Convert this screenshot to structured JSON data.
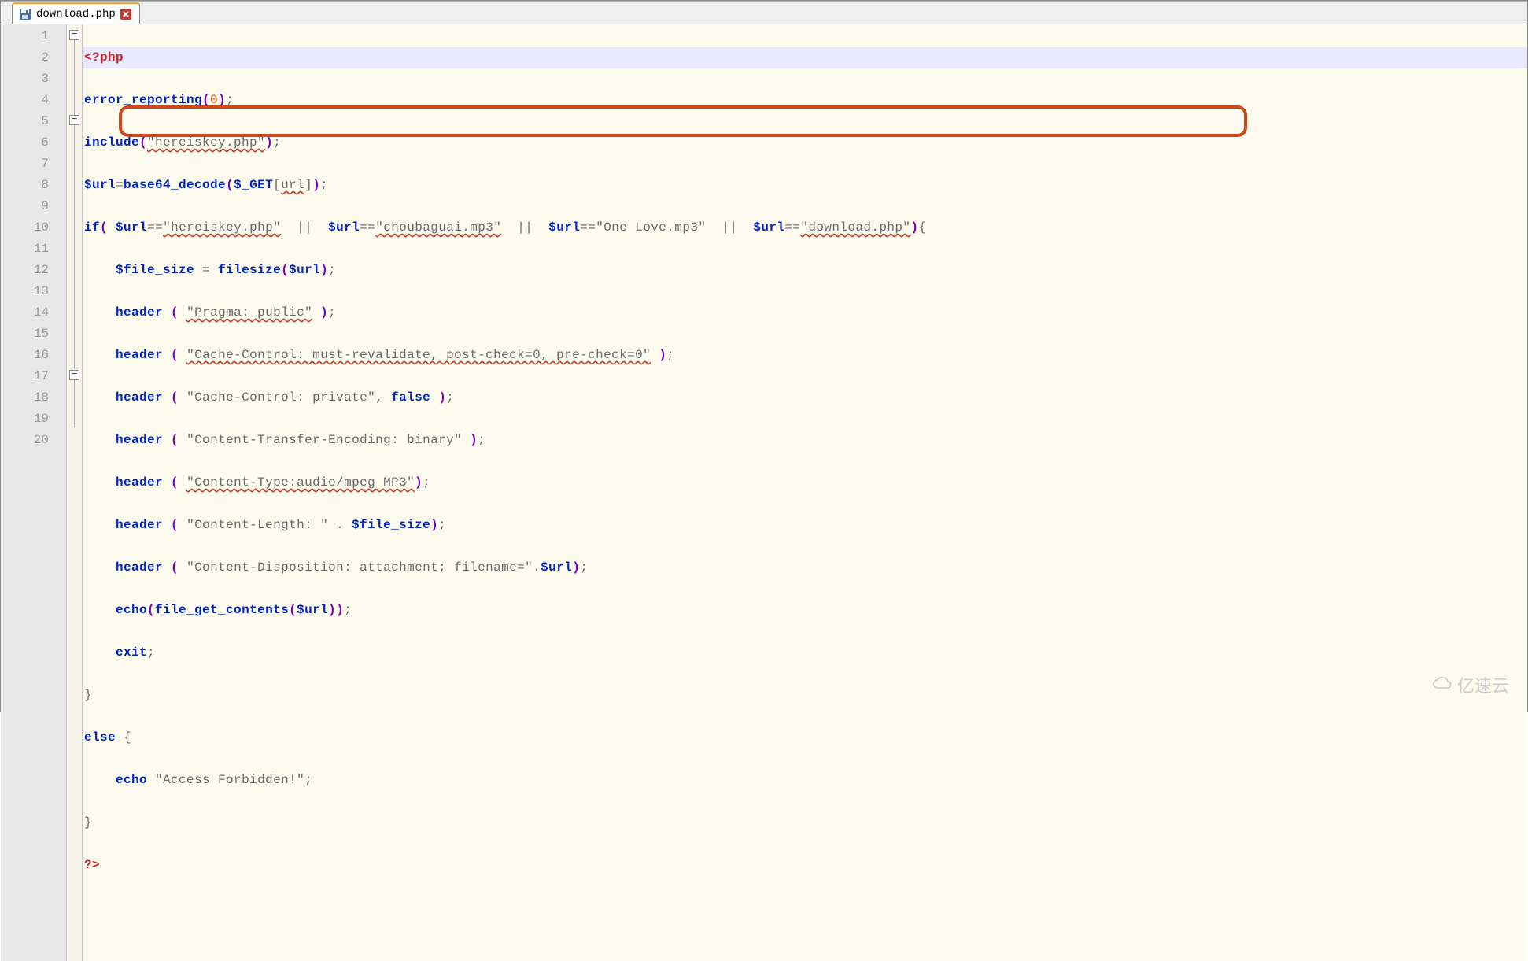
{
  "tab": {
    "filename": "download.php"
  },
  "gutter": [
    "1",
    "2",
    "3",
    "4",
    "5",
    "6",
    "7",
    "8",
    "9",
    "10",
    "11",
    "12",
    "13",
    "14",
    "15",
    "16",
    "17",
    "18",
    "19",
    "20"
  ],
  "code": {
    "l1": {
      "phptag": "<?php"
    },
    "l2": {
      "fn": "error_reporting",
      "num": "0"
    },
    "l3": {
      "fn": "include",
      "str": "\"hereiskey.php\""
    },
    "l4": {
      "var1": "$url",
      "fn": "base64_decode",
      "var2": "$_GET",
      "idx": "url"
    },
    "l5": {
      "kw": "if",
      "var": "$url",
      "s1": "\"hereiskey.php\"",
      "s2": "\"choubaguai.mp3\"",
      "s3": "\"One Love.mp3\"",
      "s4": "\"download.php\""
    },
    "l6": {
      "var1": "$file_size",
      "fn": "filesize",
      "var2": "$url"
    },
    "l7": {
      "fn": "header",
      "str": "\"Pragma: public\""
    },
    "l8": {
      "fn": "header",
      "str": "\"Cache-Control: must-revalidate, post-check=0, pre-check=0\""
    },
    "l9": {
      "fn": "header",
      "str": "\"Cache-Control: private\"",
      "kw": "false"
    },
    "l10": {
      "fn": "header",
      "str": "\"Content-Transfer-Encoding: binary\""
    },
    "l11": {
      "fn": "header",
      "str": "\"Content-Type:audio/mpeg MP3\""
    },
    "l12": {
      "fn": "header",
      "str": "\"Content-Length: \"",
      "var": "$file_size"
    },
    "l13": {
      "fn": "header",
      "str": "\"Content-Disposition: attachment; filename=\"",
      "var": "$url"
    },
    "l14": {
      "kw": "echo",
      "fn": "file_get_contents",
      "var": "$url"
    },
    "l15": {
      "kw": "exit"
    },
    "l17": {
      "kw": "else"
    },
    "l18": {
      "kw": "echo",
      "str": "\"Access Forbidden!\""
    },
    "l20": {
      "phptag": "?>"
    }
  },
  "watermark": "亿速云"
}
